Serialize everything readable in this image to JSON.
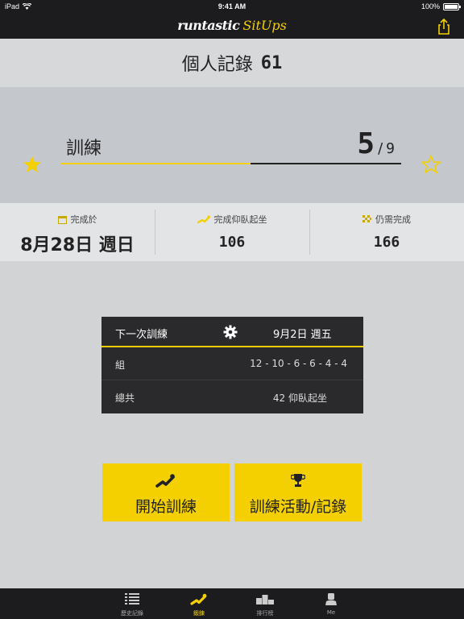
{
  "status_bar": {
    "device": "iPad",
    "time": "9:41 AM",
    "battery": "100%"
  },
  "nav": {
    "brand": "runtastic",
    "app": "SitUps",
    "share_icon": "share-icon"
  },
  "personal_record": {
    "label": "個人記錄",
    "value": "61"
  },
  "training_progress": {
    "label": "訓練",
    "current": "5",
    "separator": "/",
    "total": "9",
    "fraction": 0.556
  },
  "stats": {
    "completed_on": {
      "label": "完成於",
      "value": "8月28日 週日",
      "icon": "calendar-icon"
    },
    "situps_done": {
      "label": "完成仰臥起坐",
      "value": "106",
      "icon": "situp-icon"
    },
    "remaining": {
      "label": "仍需完成",
      "value": "166",
      "icon": "finish-flag-icon"
    }
  },
  "next_training": {
    "title": "下一次訓練",
    "date": "9月2日 週五",
    "sets_label": "組",
    "sets_value": "12 - 10 - 6 - 6 - 4 - 4",
    "total_label": "總共",
    "total_value": "42 仰臥起坐"
  },
  "actions": {
    "start_label": "開始訓練",
    "activity_label": "訓練活動/記錄"
  },
  "tabs": [
    {
      "label": "歷史記錄",
      "icon": "list-icon"
    },
    {
      "label": "鍛鍊",
      "icon": "situp-icon"
    },
    {
      "label": "排行榜",
      "icon": "podium-icon"
    },
    {
      "label": "Me",
      "icon": "person-icon"
    }
  ],
  "colors": {
    "accent": "#f4d000",
    "dark": "#1c1c1e",
    "card": "#2a2a2c"
  }
}
